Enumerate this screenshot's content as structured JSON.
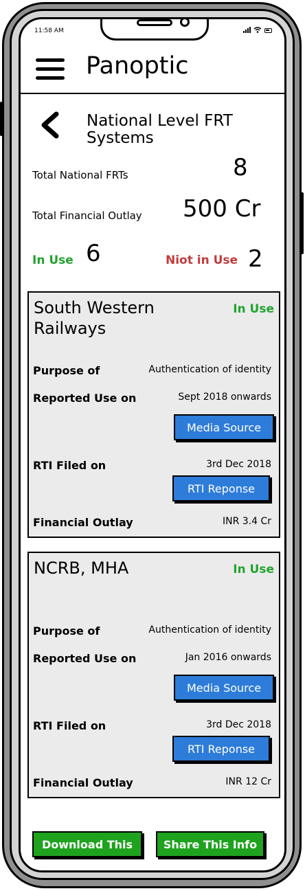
{
  "status_bar": {
    "time": "11:58 AM",
    "icons": [
      "signal-icon",
      "wifi-icon",
      "battery-icon"
    ]
  },
  "header": {
    "title": "Panoptic",
    "menu_icon": "hamburger-menu-icon"
  },
  "page": {
    "back_icon": "chevron-left-icon",
    "title": "National Level FRT Systems"
  },
  "summary": {
    "total_frts_label": "Total National FRTs",
    "total_frts_value": "8",
    "outlay_label": "Total Financial Outlay",
    "outlay_value": "500 Cr",
    "in_use_label": "In Use",
    "in_use_value": "6",
    "not_in_use_label": "Niot in Use",
    "not_in_use_value": "2"
  },
  "cards": [
    {
      "title": "South Western Railways",
      "status": "In Use",
      "purpose_label": "Purpose of",
      "purpose_value": "Authentication of identity",
      "reported_label": "Reported Use on",
      "reported_value": "Sept 2018 onwards",
      "media_button": "Media Source",
      "rti_label": "RTI Filed on",
      "rti_value": "3rd Dec 2018",
      "rti_button": "RTI Reponse",
      "outlay_label": "Financial Outlay",
      "outlay_value": "INR 3.4 Cr"
    },
    {
      "title": "NCRB, MHA",
      "status": "In Use",
      "purpose_label": "Purpose of",
      "purpose_value": "Authentication of identity",
      "reported_label": "Reported Use on",
      "reported_value": "Jan 2016 onwards",
      "media_button": "Media Source",
      "rti_label": "RTI Filed on",
      "rti_value": "3rd Dec 2018",
      "rti_button": "RTI Reponse",
      "outlay_label": "Financial Outlay",
      "outlay_value": "INR 12 Cr"
    }
  ],
  "footer": {
    "download_button": "Download This",
    "share_button": "Share This Info"
  },
  "colors": {
    "in_use": "#22a32d",
    "not_in_use": "#c23b3b",
    "button_blue": "#2e7cd9",
    "button_green": "#1fa31f"
  }
}
